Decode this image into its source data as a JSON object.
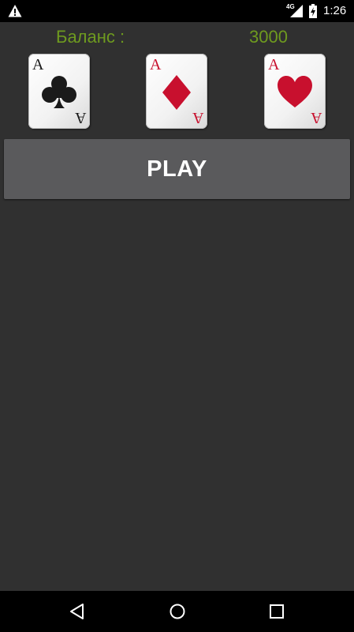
{
  "status_bar": {
    "network_label": "4G",
    "time": "1:26",
    "icons": [
      "alert-triangle-icon",
      "signal-icon",
      "battery-charging-icon"
    ]
  },
  "balance": {
    "label": "Баланс :",
    "value": "3000",
    "color": "#6e9a1f"
  },
  "cards": [
    {
      "rank": "A",
      "suit": "clubs",
      "color": "#1a1a1a"
    },
    {
      "rank": "A",
      "suit": "diamonds",
      "color": "#c8102e"
    },
    {
      "rank": "A",
      "suit": "hearts",
      "color": "#c8102e"
    }
  ],
  "play_button": {
    "label": "PLAY"
  },
  "nav_bar": {
    "buttons": [
      "back-icon",
      "home-icon",
      "recents-icon"
    ]
  }
}
